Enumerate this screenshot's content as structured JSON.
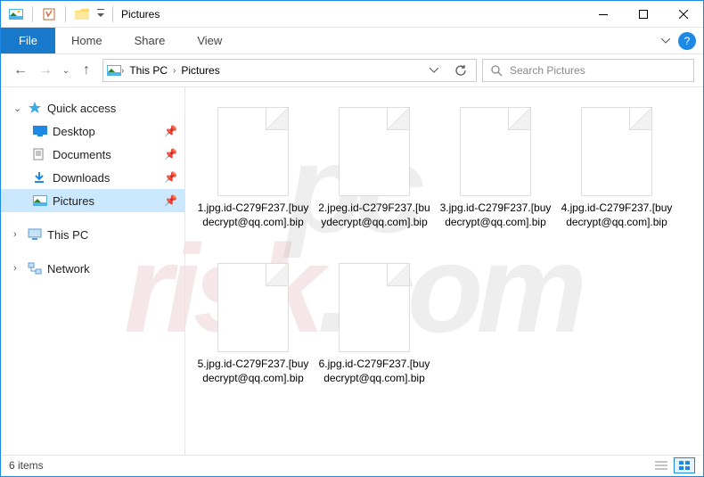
{
  "titlebar": {
    "title": "Pictures"
  },
  "ribbon": {
    "file": "File",
    "tabs": [
      "Home",
      "Share",
      "View"
    ]
  },
  "breadcrumb": {
    "root": "This PC",
    "current": "Pictures"
  },
  "search": {
    "placeholder": "Search Pictures"
  },
  "sidebar": {
    "quick_access": "Quick access",
    "items": [
      {
        "label": "Desktop"
      },
      {
        "label": "Documents"
      },
      {
        "label": "Downloads"
      },
      {
        "label": "Pictures"
      }
    ],
    "this_pc": "This PC",
    "network": "Network"
  },
  "files": [
    {
      "name": "1.jpg.id-C279F237.[buydecrypt@qq.com].bip"
    },
    {
      "name": "2.jpeg.id-C279F237.[buydecrypt@qq.com].bip"
    },
    {
      "name": "3.jpg.id-C279F237.[buydecrypt@qq.com].bip"
    },
    {
      "name": "4.jpg.id-C279F237.[buydecrypt@qq.com].bip"
    },
    {
      "name": "5.jpg.id-C279F237.[buydecrypt@qq.com].bip"
    },
    {
      "name": "6.jpg.id-C279F237.[buydecrypt@qq.com].bip"
    }
  ],
  "status": {
    "count": "6 items"
  },
  "watermark": "pcrisk.com"
}
